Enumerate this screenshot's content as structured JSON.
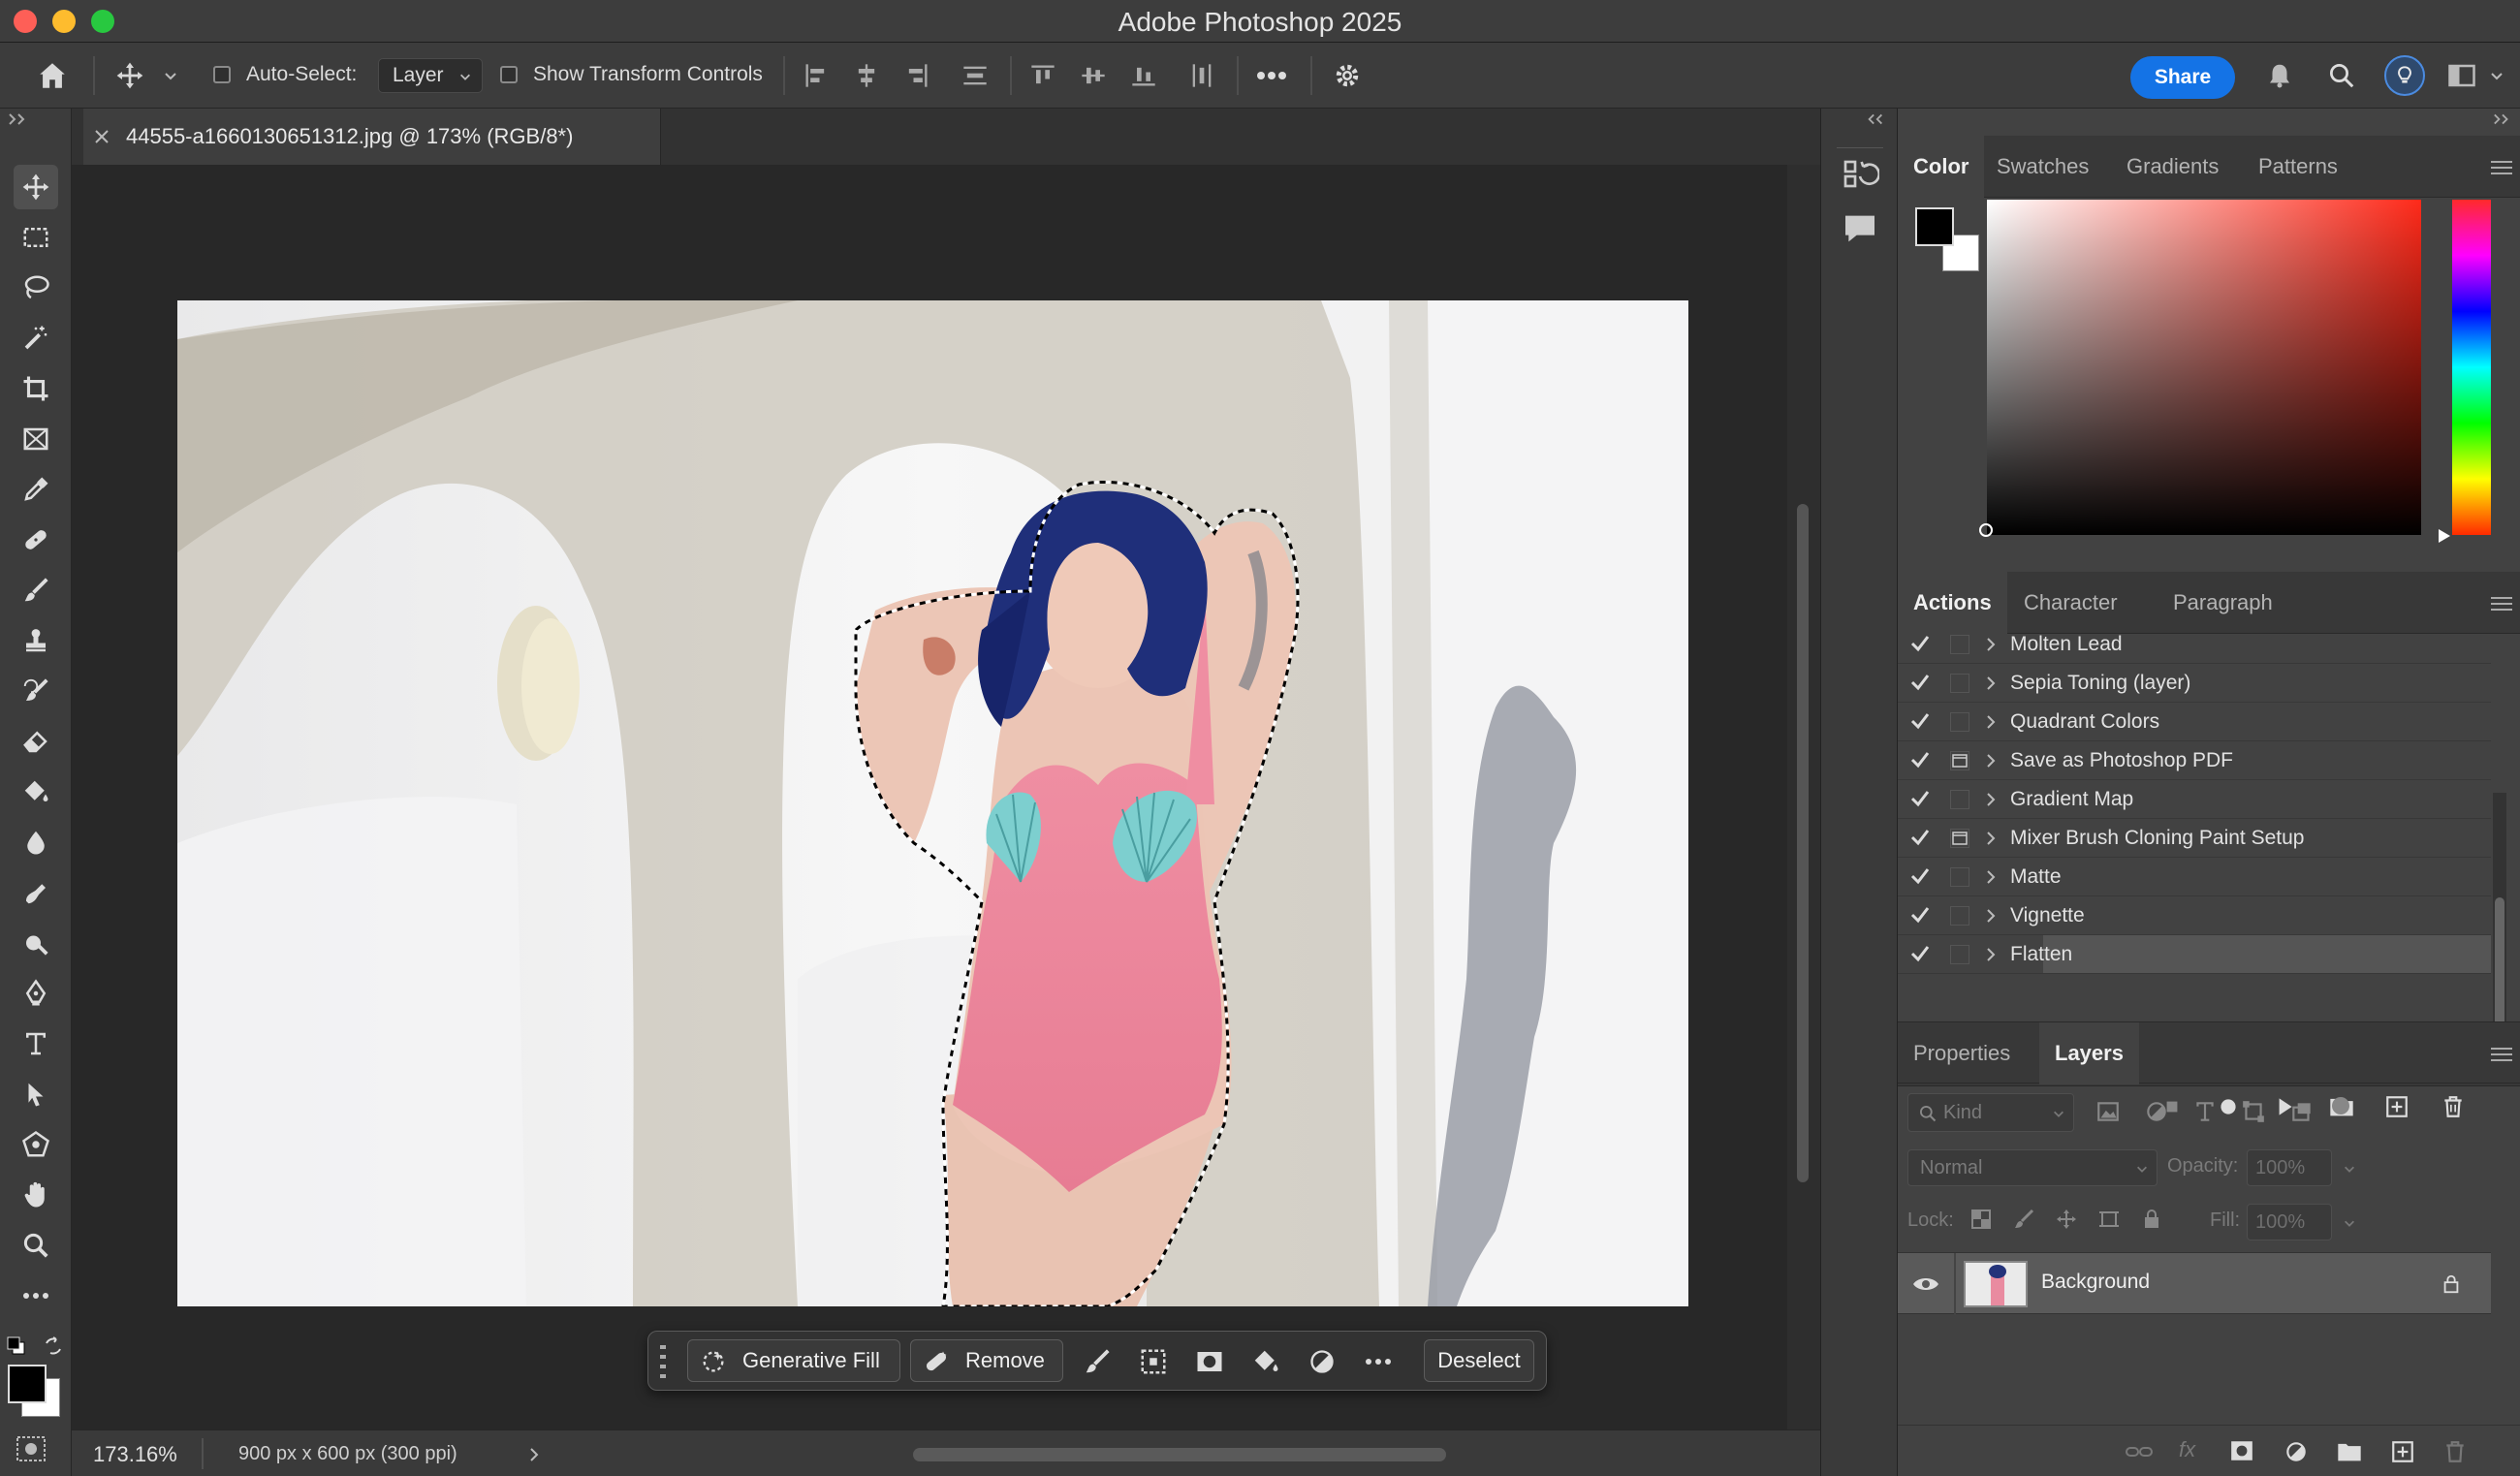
{
  "app": {
    "title": "Adobe Photoshop 2025"
  },
  "options": {
    "auto_select_label": "Auto-Select:",
    "auto_select_value": "Layer",
    "transform_label": "Show Transform Controls",
    "share_label": "Share"
  },
  "document": {
    "tab_title": "44555-a1660130651312.jpg @ 173% (RGB/8*)",
    "zoom": "173.16%",
    "dimensions": "900 px x 600 px (300 ppi)"
  },
  "color_panel": {
    "tabs": [
      "Color",
      "Swatches",
      "Gradients",
      "Patterns"
    ]
  },
  "actions_panel": {
    "tabs": [
      "Actions",
      "Character",
      "Paragraph"
    ],
    "items": [
      {
        "label": "Molten Lead",
        "has_dialog": false
      },
      {
        "label": "Sepia Toning (layer)",
        "has_dialog": false
      },
      {
        "label": "Quadrant Colors",
        "has_dialog": false
      },
      {
        "label": "Save as Photoshop PDF",
        "has_dialog": true
      },
      {
        "label": "Gradient Map",
        "has_dialog": false
      },
      {
        "label": "Mixer Brush Cloning Paint Setup",
        "has_dialog": true
      },
      {
        "label": "Matte",
        "has_dialog": false
      },
      {
        "label": "Vignette",
        "has_dialog": false
      },
      {
        "label": "Flatten",
        "has_dialog": false
      }
    ]
  },
  "layers_panel": {
    "tabs": [
      "Properties",
      "Layers"
    ],
    "kind_placeholder": "Kind",
    "blend_mode": "Normal",
    "opacity_label": "Opacity:",
    "opacity_value": "100%",
    "lock_label": "Lock:",
    "fill_label": "Fill:",
    "fill_value": "100%",
    "layers": [
      {
        "name": "Background",
        "visible": true,
        "locked": true
      }
    ]
  },
  "context_bar": {
    "generative_fill_label": "Generative Fill",
    "remove_label": "Remove",
    "deselect_label": "Deselect"
  },
  "colors": {
    "accent": "#1473e6",
    "foreground": "#000000",
    "background": "#ffffff"
  },
  "icons": [
    "home-icon",
    "move-icon",
    "marquee-icon",
    "lasso-icon",
    "magic-wand-icon",
    "crop-icon",
    "frame-icon",
    "eyedropper-icon",
    "healing-brush-icon",
    "brush-icon",
    "stamp-icon",
    "history-brush-icon",
    "eraser-icon",
    "paint-bucket-icon",
    "blur-icon",
    "dodge-icon",
    "smudge-icon",
    "pen-icon",
    "type-icon",
    "path-selection-icon",
    "shape-icon",
    "hand-icon",
    "zoom-icon",
    "more-icon",
    "gear-icon",
    "bell-icon",
    "search-icon",
    "lightbulb-icon",
    "workspace-icon"
  ]
}
